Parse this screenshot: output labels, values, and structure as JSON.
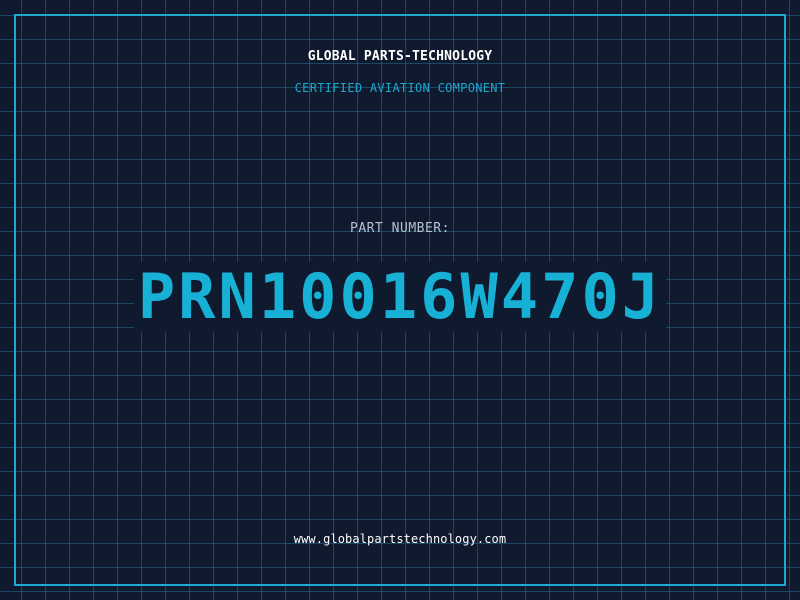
{
  "header": {
    "brand": "GLOBAL PARTS-TECHNOLOGY",
    "subtitle": "CERTIFIED AVIATION COMPONENT"
  },
  "part": {
    "label": "PART NUMBER:",
    "number": "PRN10016W470J"
  },
  "footer": {
    "url": "www.globalpartstechnology.com"
  },
  "colors": {
    "background": "#101a2e",
    "grid": "#1f6e8c",
    "accent": "#1ea7cf",
    "part_number": "#18b1d6",
    "label": "#b5c2cf",
    "text": "#ffffff"
  }
}
